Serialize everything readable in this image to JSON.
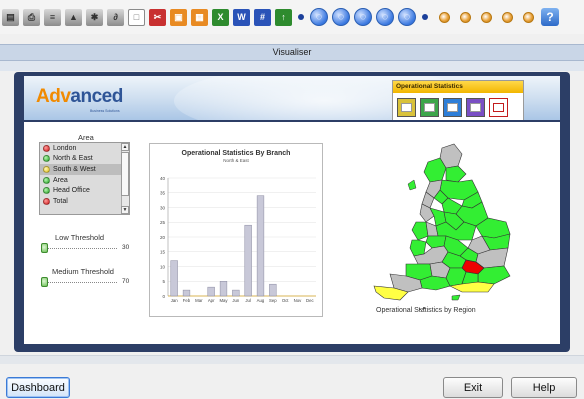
{
  "window": {
    "title": "Visualiser"
  },
  "logo": {
    "text_a": "Adv",
    "text_b": "anced",
    "subtitle": "Business Solutions"
  },
  "ops_panel": {
    "title": "Operational Statistics",
    "icons": [
      "edit-icon",
      "chart-icon",
      "table-icon",
      "report-icon",
      "export-icon"
    ]
  },
  "area": {
    "label": "Area",
    "items": [
      {
        "label": "London",
        "status": "red"
      },
      {
        "label": "North & East",
        "status": "green"
      },
      {
        "label": "South & West",
        "status": "yellow",
        "selected": true
      },
      {
        "label": "Area",
        "status": "green"
      },
      {
        "label": "Head Office",
        "status": "green"
      },
      {
        "label": "Total",
        "status": "red"
      }
    ]
  },
  "thresholds": {
    "low": {
      "label": "Low Threshold",
      "value": "30"
    },
    "medium": {
      "label": "Medium Threshold",
      "value": "70"
    }
  },
  "chart_data": {
    "type": "bar",
    "title": "Operational Statistics By Branch",
    "subtitle": "North & East",
    "categories": [
      "Jan",
      "Feb",
      "Mar",
      "Apr",
      "May",
      "Jun",
      "Jul",
      "Aug",
      "Sep",
      "Oct",
      "Nov",
      "Dec"
    ],
    "values": [
      12,
      2,
      0,
      3,
      5,
      2,
      24,
      34,
      4,
      0,
      0,
      0
    ],
    "ylim": [
      0,
      40
    ],
    "yticks": [
      0,
      5,
      10,
      15,
      20,
      25,
      30,
      35,
      40
    ],
    "grid": true,
    "bar_color": "#c8c8d8"
  },
  "map": {
    "caption": "Operational Statistics by Region"
  },
  "buttons": {
    "dashboard": "Dashboard",
    "exit": "Exit",
    "help": "Help"
  },
  "colors": {
    "frame": "#2c3e66",
    "map_green": "#33ee33",
    "map_grey": "#c0c0c0",
    "map_red": "#ee0000",
    "map_yellow": "#ffff44"
  }
}
